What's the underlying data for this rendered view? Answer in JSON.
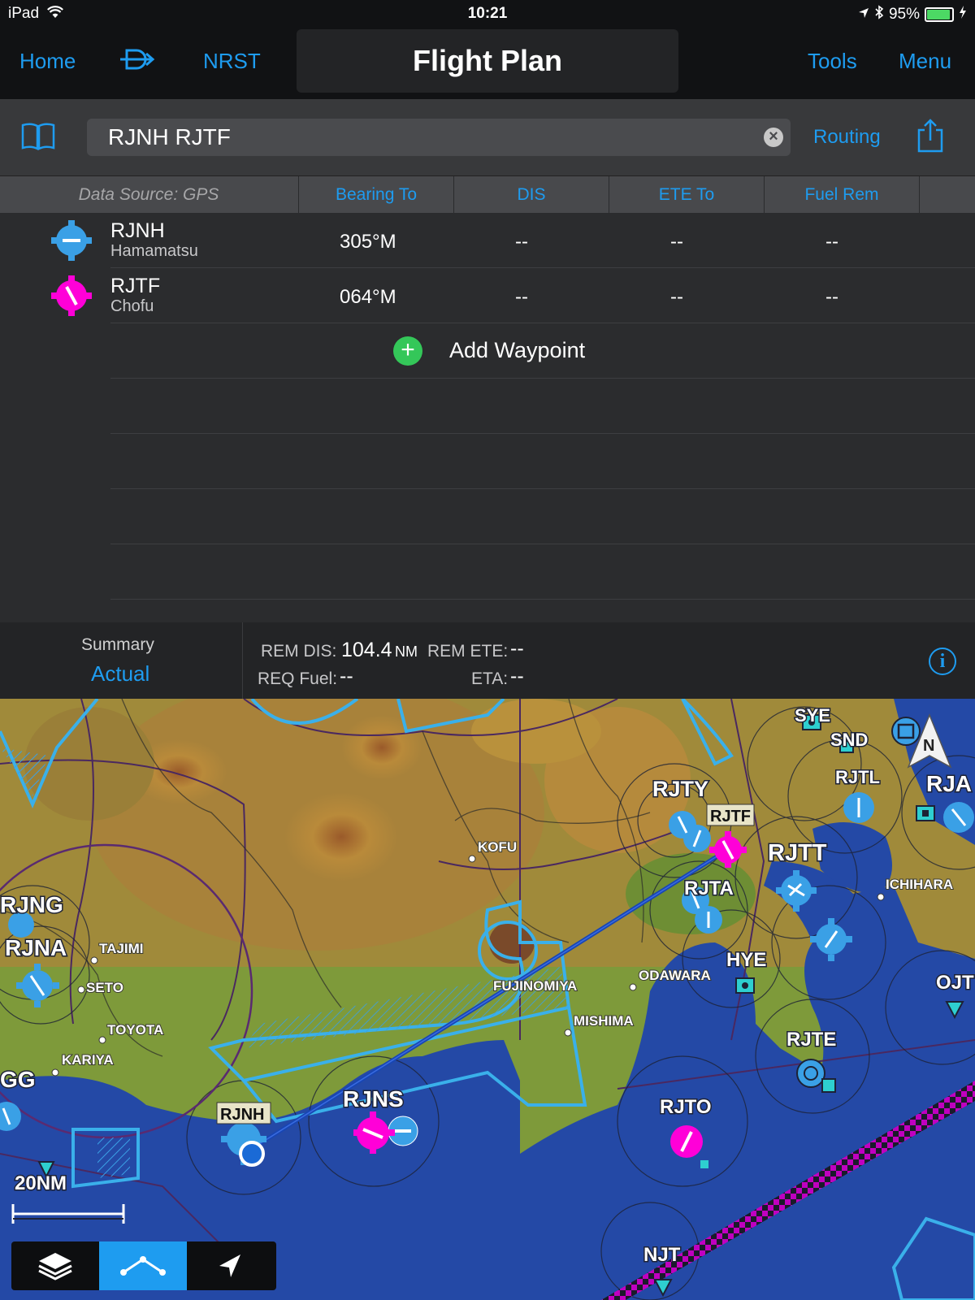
{
  "status": {
    "device": "iPad",
    "time": "10:21",
    "battery": "95%",
    "battery_level": 0.95
  },
  "nav": {
    "home": "Home",
    "nrst": "NRST",
    "title": "Flight Plan",
    "tools": "Tools",
    "menu": "Menu"
  },
  "toolbar": {
    "route": "RJNH RJTF",
    "routing": "Routing"
  },
  "columns": {
    "source": "Data Source: GPS",
    "bearing": "Bearing To",
    "dis": "DIS",
    "ete": "ETE To",
    "fuel": "Fuel Rem"
  },
  "waypoints": [
    {
      "ident": "RJNH",
      "name": "Hamamatsu",
      "bearing": "305°M",
      "dis": "--",
      "ete": "--",
      "fuel": "--"
    },
    {
      "ident": "RJTF",
      "name": "Chofu",
      "bearing": "064°M",
      "dis": "--",
      "ete": "--",
      "fuel": "--"
    }
  ],
  "add_waypoint": "Add Waypoint",
  "summary": {
    "title": "Summary",
    "mode": "Actual",
    "rem_dis_label": "REM DIS:",
    "rem_dis_value": "104.4",
    "rem_dis_unit": "NM",
    "rem_ete_label": "REM ETE:",
    "rem_ete_value": "--",
    "req_fuel_label": "REQ Fuel:",
    "req_fuel_value": "--",
    "eta_label": "ETA:",
    "eta_value": "--"
  },
  "map": {
    "labels": {
      "syee": "SYE",
      "snd": "SND",
      "rjtl": "RJTL",
      "rja": "RJA",
      "rjty": "RJTY",
      "rjtf": "RJTF",
      "rjtt": "RJTT",
      "kofu": "KOFU",
      "rjta": "RJTA",
      "ichihara": "ICHIHARA",
      "rjng": "RJNG",
      "rjna": "RJNA",
      "tajimi": "TAJIMI",
      "seto": "SETO",
      "hye": "HYE",
      "odawara": "ODAWARA",
      "ojt": "OJT",
      "fujinomiya": "FUJINOMIYA",
      "mishima": "MISHIMA",
      "toyota": "TOYOTA",
      "kariya": "KARIYA",
      "gg": "GG",
      "rjte": "RJTE",
      "rjnh": "RJNH",
      "rjns": "RJNS",
      "rjto": "RJTO",
      "njt": "NJT",
      "north": "N"
    },
    "scale": "20NM",
    "colors": {
      "accent": "#1e9cf0",
      "magenta": "#ff00d8",
      "water": "#2449a6",
      "route": "#1846b4"
    }
  }
}
